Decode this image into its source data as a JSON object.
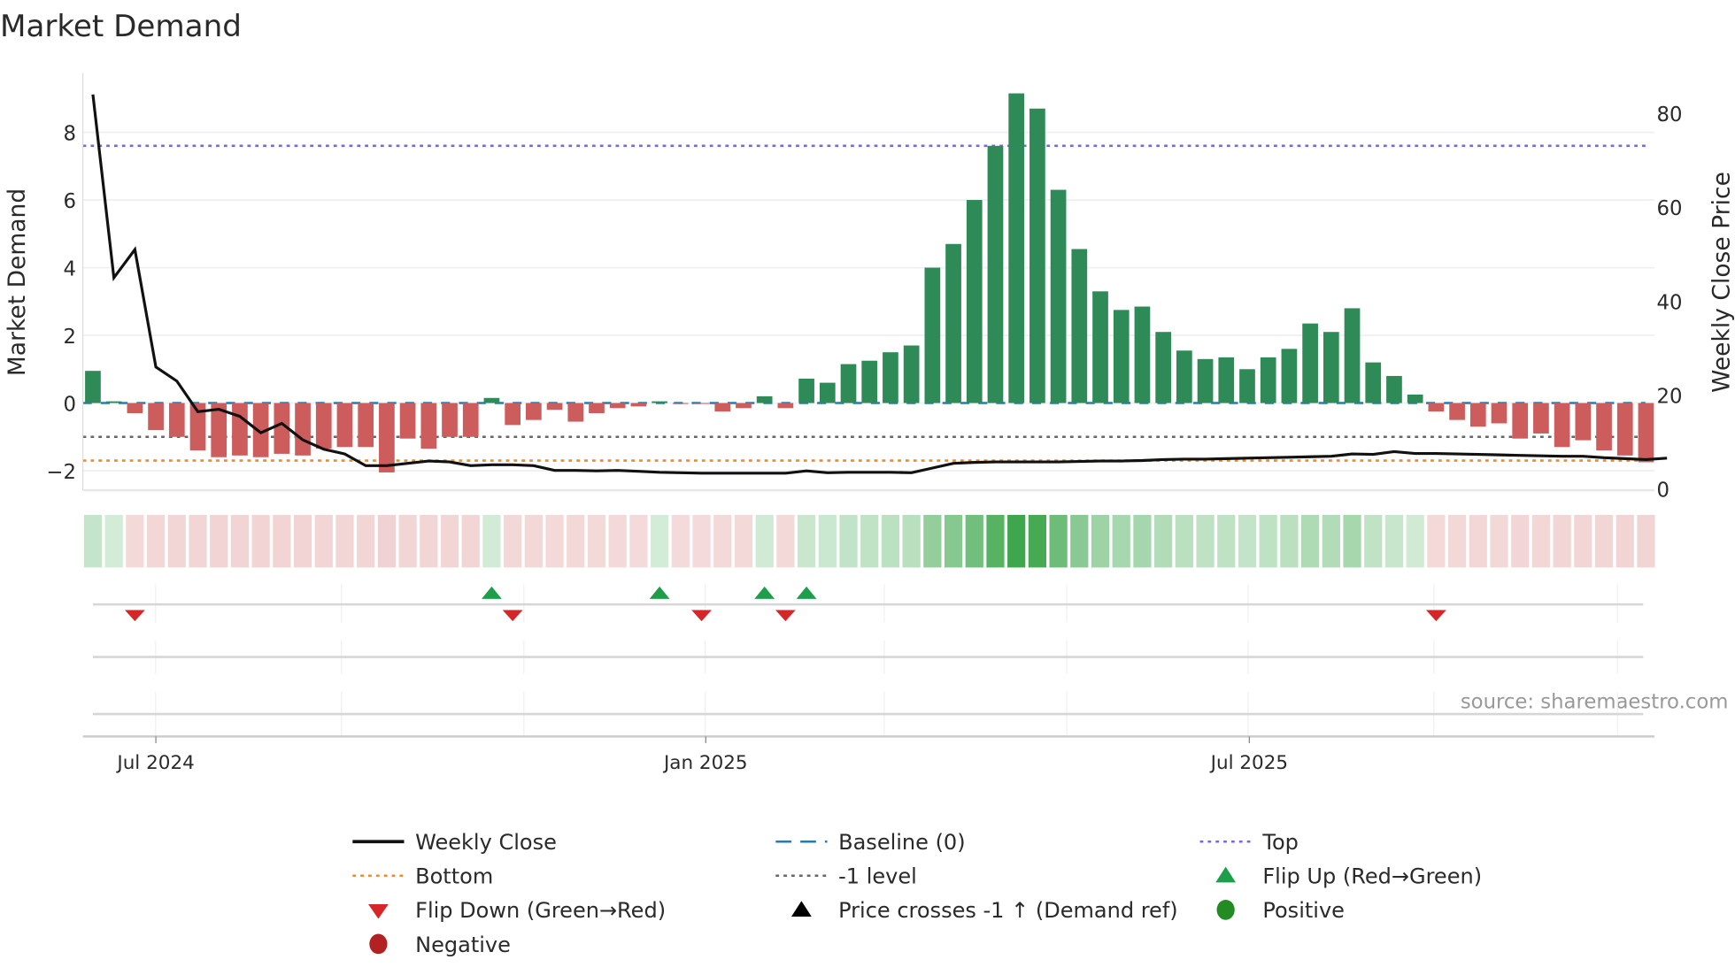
{
  "chart_data": {
    "type": "bar",
    "title": "Market Demand",
    "ylabel": "Market Demand",
    "y2label": "Weekly Close Price",
    "ylim": [
      -2.5,
      9.6
    ],
    "y2lim": [
      0,
      88
    ],
    "yticks": [
      -2,
      0,
      2,
      4,
      6,
      8
    ],
    "y2ticks": [
      0,
      20,
      40,
      60,
      80
    ],
    "xticks": [
      {
        "label": "Jul 2024",
        "week": 3
      },
      {
        "label": "Jan 2025",
        "week": 29.2
      },
      {
        "label": "Jul 2025",
        "week": 55.1
      }
    ],
    "demand": [
      0.95,
      0.05,
      -0.3,
      -0.8,
      -1.0,
      -1.4,
      -1.6,
      -1.55,
      -1.6,
      -1.5,
      -1.55,
      -1.35,
      -1.3,
      -1.3,
      -2.05,
      -1.05,
      -1.35,
      -1.0,
      -1.0,
      0.15,
      -0.65,
      -0.5,
      -0.2,
      -0.55,
      -0.3,
      -0.15,
      -0.1,
      0.05,
      -0.02,
      -0.02,
      -0.25,
      -0.15,
      0.2,
      -0.15,
      0.72,
      0.6,
      1.15,
      1.25,
      1.5,
      1.7,
      4.0,
      4.7,
      6.0,
      7.6,
      9.15,
      8.7,
      6.3,
      4.55,
      3.3,
      2.75,
      2.85,
      2.1,
      1.55,
      1.3,
      1.35,
      1.0,
      1.35,
      1.6,
      2.35,
      2.1,
      2.8,
      1.2,
      0.8,
      0.25,
      -0.25,
      -0.5,
      -0.7,
      -0.6,
      -1.05,
      -0.9,
      -1.3,
      -1.1,
      -1.4,
      -1.55,
      -1.75
    ],
    "weekly_close": [
      84,
      45,
      51,
      26,
      23,
      16.5,
      17,
      15.5,
      12,
      14,
      10.5,
      8.5,
      7.5,
      5,
      5,
      5.5,
      6,
      5.8,
      5,
      5.2,
      5.2,
      5,
      4,
      4,
      3.9,
      4,
      3.8,
      3.6,
      3.5,
      3.4,
      3.4,
      3.4,
      3.4,
      3.4,
      3.9,
      3.5,
      3.6,
      3.6,
      3.6,
      3.5,
      4.5,
      5.5,
      5.7,
      5.8,
      5.8,
      5.8,
      5.8,
      5.9,
      6,
      6,
      6.1,
      6.3,
      6.4,
      6.4,
      6.5,
      6.6,
      6.7,
      6.8,
      6.9,
      7,
      7.5,
      7.4,
      8,
      7.6,
      7.6,
      7.5,
      7.4,
      7.3,
      7.2,
      7.1,
      7,
      7,
      6.7,
      6.5,
      6.3,
      6.6
    ],
    "levels": {
      "baseline": 0,
      "minus_one": -1,
      "top": 7.6,
      "bottom": -1.7
    },
    "flip_up_weeks": [
      19,
      27,
      32,
      34
    ],
    "flip_down_weeks": [
      2,
      20,
      29,
      33,
      64
    ],
    "legend": {
      "placement": "bottom-center",
      "items": [
        {
          "label": "Weekly Close",
          "symbol": "line",
          "color": "#111111"
        },
        {
          "label": "Baseline (0)",
          "symbol": "dash",
          "color": "#2a7ab0"
        },
        {
          "label": "Top",
          "symbol": "dot",
          "color": "#7b68d8"
        },
        {
          "label": "Bottom",
          "symbol": "dot",
          "color": "#f08a24"
        },
        {
          "label": "-1 level",
          "symbol": "dot",
          "color": "#666666"
        },
        {
          "label": "Flip Up (Red→Green)",
          "symbol": "tri-up",
          "color": "#1e9e4a"
        },
        {
          "label": "Flip Down (Green→Red)",
          "symbol": "tri-down",
          "color": "#d62728"
        },
        {
          "label": "Price crosses -1 ↑ (Demand ref)",
          "symbol": "tri-up",
          "color": "#000000"
        },
        {
          "label": "Positive",
          "symbol": "circle",
          "color": "#228b22"
        },
        {
          "label": "Negative",
          "symbol": "circle",
          "color": "#b22222"
        }
      ]
    },
    "colors": {
      "positive": "#2e8b57",
      "negative": "#cd5c5c"
    },
    "source": "source: sharemaestro.com"
  }
}
